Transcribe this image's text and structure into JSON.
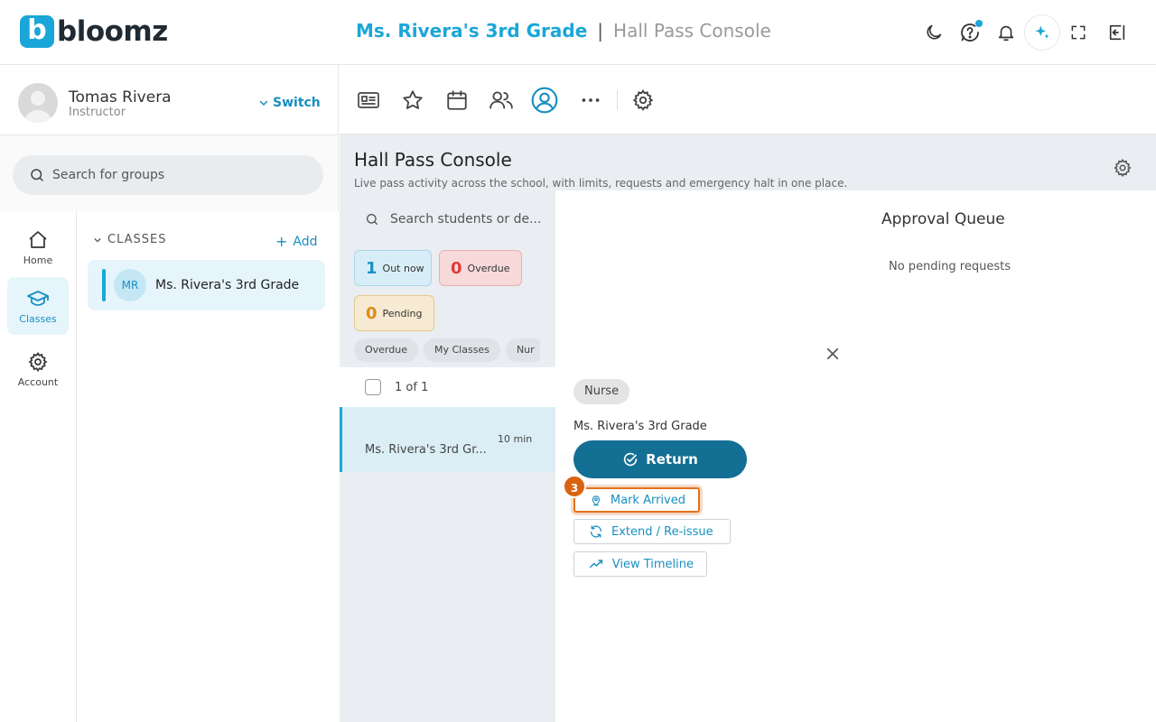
{
  "header": {
    "logo_letter": "b",
    "logo_text": "bloomz",
    "class_title": "Ms. Rivera's 3rd Grade",
    "separator": "|",
    "page_title": "Hall Pass Console"
  },
  "user": {
    "name": "Tomas Rivera",
    "role": "Instructor",
    "switch_label": "Switch"
  },
  "search_groups": {
    "placeholder": "Search for groups"
  },
  "rail": {
    "home": "Home",
    "classes": "Classes",
    "account": "Account"
  },
  "classes": {
    "heading": "CLASSES",
    "add_label": "Add",
    "plus": "+",
    "items": [
      {
        "initials": "MR",
        "name": "Ms. Rivera's 3rd Grade"
      }
    ]
  },
  "console": {
    "title": "Hall Pass Console",
    "subtitle": "Live pass activity across the school, with limits, requests and emergency halt in one place.",
    "search_placeholder": "Search students or de...",
    "stats": {
      "out_num": "1",
      "out_label": "Out now",
      "overdue_num": "0",
      "overdue_label": "Overdue",
      "pending_num": "0",
      "pending_label": "Pending"
    },
    "filters": [
      "Overdue",
      "My Classes",
      "Nur"
    ],
    "count_label": "1 of 1",
    "rows": [
      {
        "time": "10 min",
        "name": "Ms. Rivera's 3rd Gr..."
      }
    ]
  },
  "queue": {
    "title": "Approval Queue",
    "empty": "No pending requests"
  },
  "pass_detail": {
    "destination": "Nurse",
    "class_name": "Ms. Rivera's 3rd Grade",
    "return_label": "Return",
    "mark_arrived_label": "Mark Arrived",
    "extend_label": "Extend / Re-issue",
    "timeline_label": "View Timeline",
    "step_number": "3"
  },
  "colors": {
    "brand": "#1aa6d8",
    "return_button": "#136f93",
    "highlight": "#e2711d",
    "overdue": "#e03b3b",
    "pending": "#e08a1a"
  }
}
